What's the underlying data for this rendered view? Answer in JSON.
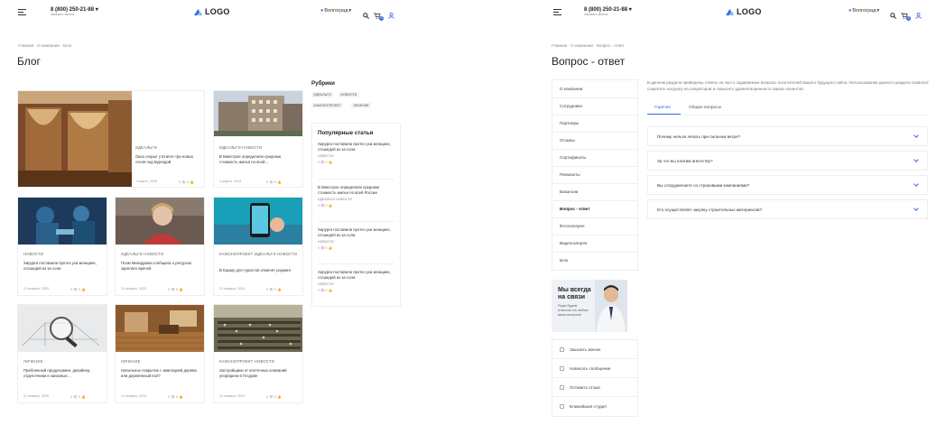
{
  "header": {
    "phone": "8 (800) 250-21-88",
    "phone_sub": "Заказать звонок",
    "logo": "LOGO",
    "city": "Волгоград",
    "cart_count": "0"
  },
  "blog": {
    "breadcrumb": "Главная  ·  О компании  ·  Блог",
    "title": "Блог",
    "cards": [
      {
        "category": "ИДЕАЛЬГИ",
        "title": "Окно открыт у Египте три новых отеля под Бургадой",
        "date": "1 марта, 2019",
        "stats": "0 👁  0 👍"
      },
      {
        "category": "ИДЕАЛЬГИ   НОВОСТИ",
        "title": "В Минстрое определили среднюю стоимость жилья по всей…",
        "date": "1 марта, 2019",
        "stats": "0 👁  0 👍"
      },
      {
        "category": "НОВОСТИ",
        "title": "Хирурги поставили протез уха женщине, отошедей из за соли",
        "date": "21 января, 2020",
        "stats": "0 👁  0 👍"
      },
      {
        "category": "ИДЕАЛЬГИ   НОВОСТИ",
        "title": "Поэм Минздрава сообщила о ресурсах зарплате врачей",
        "date": "21 января, 2020",
        "stats": "0 👁  0 👍"
      },
      {
        "category": "КАМОНОПРОЕКТ   ИДЕАЛЬГИ   НОВОСТИ",
        "title": "В Крыму для туристов отменят роуминг",
        "date": "21 января, 2020",
        "stats": "0 👁  0 👍"
      },
      {
        "category": "ЛИЧЕНИЕ",
        "title": "Пребленный продульваин, дизайнер, отделочники и занизные…",
        "date": "21 января, 2020",
        "stats": "0 👁  0 👍"
      },
      {
        "category": "ЛИЧЕНИЕ",
        "title": "Напольное покрытие с имитацией дерева или деревянный пол?",
        "date": "21 января, 2020",
        "stats": "0 👁  0 👍"
      },
      {
        "category": "КАМОНОПРОЕКТ   НОВОСТИ",
        "title": "Застройщики от ипотечных компаний упорядили в Госдуме",
        "date": "21 января, 2020",
        "stats": "0 👁  0 👍"
      }
    ],
    "rubrics_title": "Рубрики",
    "tags": [
      "ИДЕАЛЬГИ",
      "НОВОСТИ",
      "КАМОНОПРОЕКТ",
      "ЛИЧЕНИЕ"
    ],
    "popular_title": "Популярные статьи",
    "popular": [
      {
        "text": "Хирурги поставили протез уха женщине, отошедей из за соли",
        "cat": "НОВОСТИ",
        "stats": "0 👁  0 👍"
      },
      {
        "text": "В Минстрое определили среднюю стоимость жилья по всей России",
        "cat": "ИДЕАЛЬГИ    НОВОСТИ",
        "stats": "0 👁  0 👍"
      },
      {
        "text": "Хирурги поставили протез уха женщине, отошедей из за соли",
        "cat": "НОВОСТИ",
        "stats": "0 👁  0 👍"
      },
      {
        "text": "Хирурги поставили протез уха женщине, отошедей из за соли",
        "cat": "НОВОСТИ",
        "stats": "0 👁  0 👍"
      }
    ]
  },
  "faq": {
    "breadcrumb": "Главная  ·  О компании  ·  Вопрос - ответ",
    "title": "Вопрос - ответ",
    "menu": [
      "О компании",
      "Сотрудники",
      "Партнеры",
      "Отзывы",
      "Сертификаты",
      "Реквизиты",
      "Вакансии",
      "Вопрос - ответ",
      "Фотогалерея",
      "Видеогалерея",
      "Блог"
    ],
    "intro": "В данном разделе приведены ответы на часто задаваемые вопросы посетителей вашего будущего сайта. Использование данного раздела позволит сократить нагрузку на операторов и повысить удовлетворенность ваших клиентов.",
    "tabs": [
      "Горячие",
      "Общие вопросы"
    ],
    "questions": [
      "Почему нельзя лепать при сильном ветре?",
      "За что вы платим агентству?",
      "Вы сотрудничаете со страховыми компаниями?",
      "Кто осуществляет закупку строительных материалов?"
    ],
    "promo_title": "Мы всегда на связи",
    "promo_text": "Рады будем ответить на любые ваши вопросы!",
    "actions": [
      "Заказать звонок",
      "Написать сообщение",
      "Оставить отзыв",
      "Ближайшая студия"
    ],
    "accent": "#3b6fd8"
  }
}
